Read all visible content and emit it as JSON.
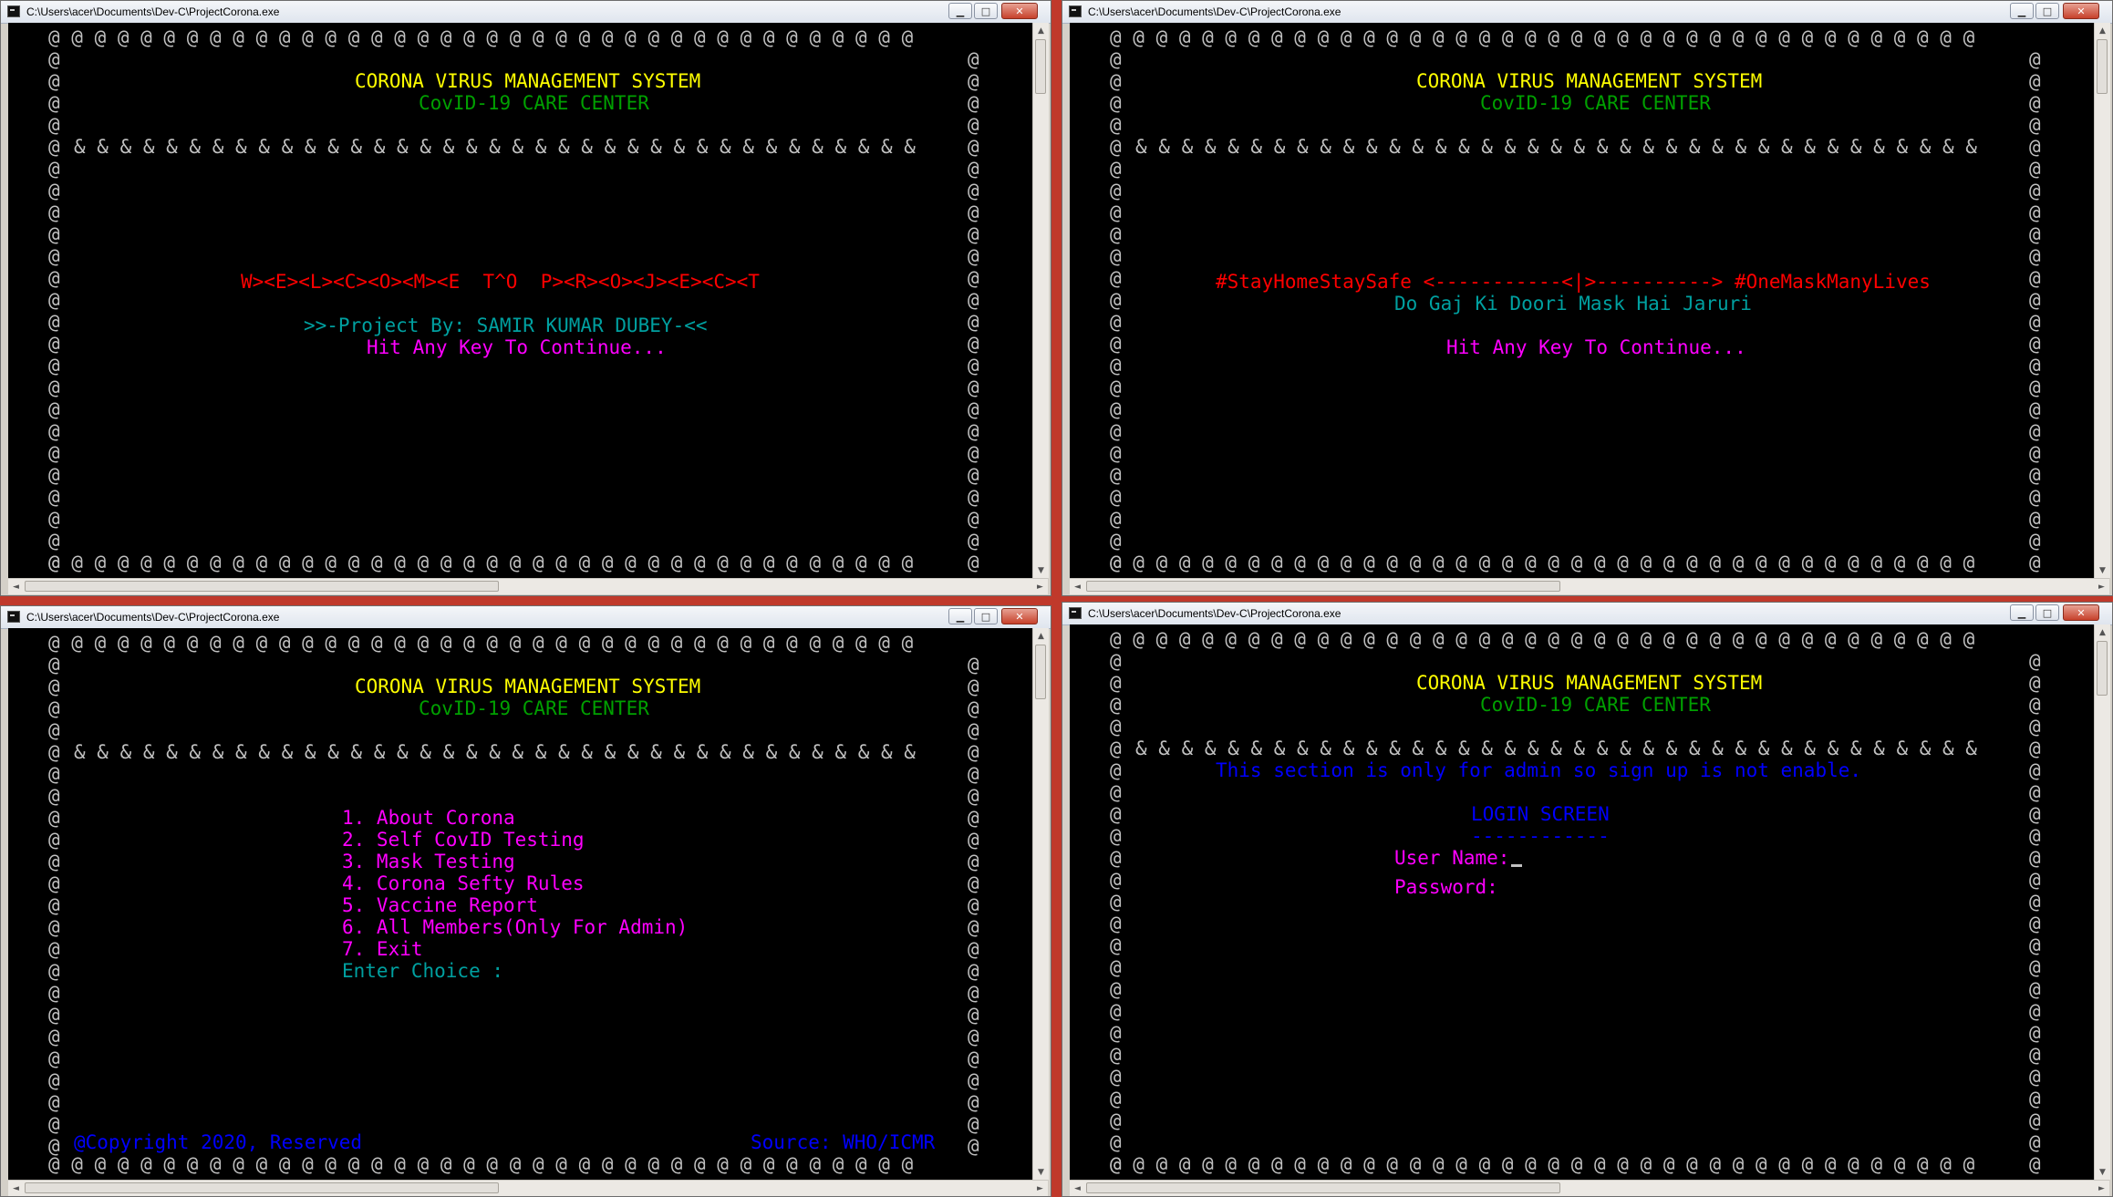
{
  "windows": [
    {
      "title": "C:\\Users\\acer\\Documents\\Dev-C\\ProjectCorona.exe",
      "header_title": "CORONA VIRUS MANAGEMENT SYSTEM",
      "header_subtitle": "CovID-19 CARE CENTER",
      "welcome": "W><E><L><C><O><M><E  T^O  P><R><O><J><E><C><T",
      "credit": ">>-Project By: SAMIR KUMAR DUBEY-<<",
      "prompt": "Hit Any Key To Continue..."
    },
    {
      "title": "C:\\Users\\acer\\Documents\\Dev-C\\ProjectCorona.exe",
      "header_title": "CORONA VIRUS MANAGEMENT SYSTEM",
      "header_subtitle": "CovID-19 CARE CENTER",
      "slogan": "#StayHomeStaySafe <-----------<|>----------> #OneMaskManyLives",
      "hindi_slogan": "Do Gaj Ki Doori Mask Hai Jaruri",
      "prompt": "Hit Any Key To Continue..."
    },
    {
      "title": "C:\\Users\\acer\\Documents\\Dev-C\\ProjectCorona.exe",
      "header_title": "CORONA VIRUS MANAGEMENT SYSTEM",
      "header_subtitle": "CovID-19 CARE CENTER",
      "menu": [
        "1. About Corona",
        "2. Self CovID Testing",
        "3. Mask Testing",
        "4. Corona Sefty Rules",
        "5. Vaccine Report",
        "6. All Members(Only For Admin)",
        "7. Exit"
      ],
      "choice_prompt": "Enter Choice :",
      "copyright": "@Copyright 2020, Reserved",
      "source": "Source: WHO/ICMR"
    },
    {
      "title": "C:\\Users\\acer\\Documents\\Dev-C\\ProjectCorona.exe",
      "header_title": "CORONA VIRUS MANAGEMENT SYSTEM",
      "header_subtitle": "CovID-19 CARE CENTER",
      "notice": "This section is only for admin so sign up is not enable.",
      "login_heading": "LOGIN SCREEN",
      "login_underline": "------------",
      "username_label": "User Name:",
      "password_label": "Password:"
    }
  ],
  "border_chars": {
    "outer": "@",
    "separator": "&"
  },
  "colors": {
    "console_bg": "#000000",
    "title": "#ffff00",
    "subtitle": "#00a000",
    "welcome": "#ff0000",
    "credit": "#00a0a0",
    "prompt": "#ff00ff",
    "notice": "#0000ff"
  }
}
